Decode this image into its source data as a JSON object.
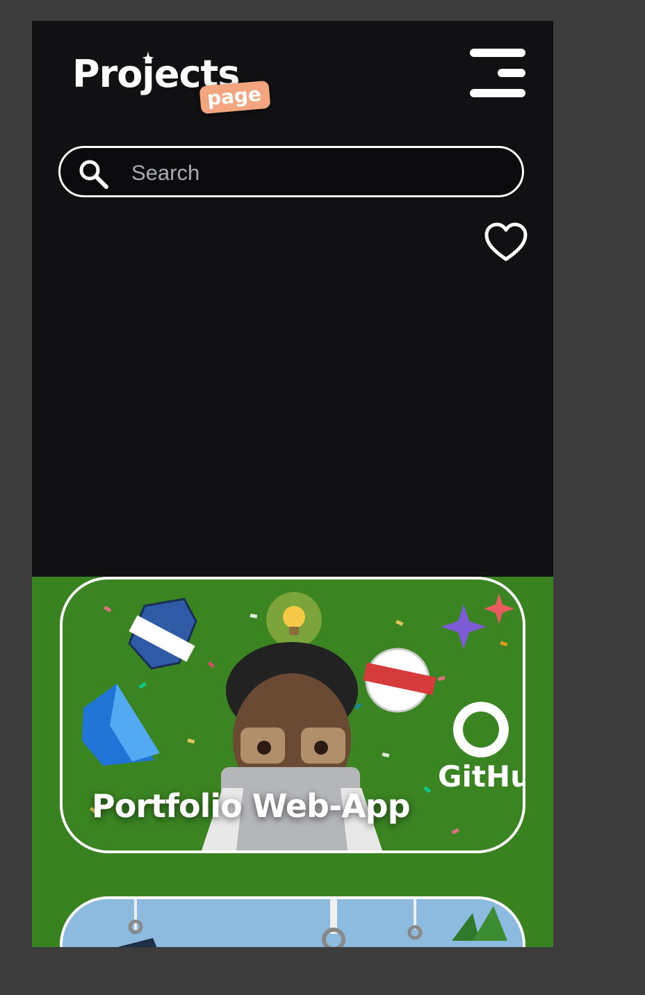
{
  "header": {
    "logo_word": "Projects",
    "logo_badge": "page",
    "menu_icon": "menu-icon"
  },
  "search": {
    "placeholder": "Search",
    "value": "",
    "icon": "search-icon"
  },
  "favorites": {
    "icon": "heart-icon"
  },
  "projects": [
    {
      "title": "Portfolio Web-App",
      "art_github_label": "GitHub"
    },
    {
      "title": ""
    }
  ],
  "colors": {
    "background": "#111113",
    "outer": "#3c3c3c",
    "section_green": "#38821f",
    "badge_orange": "#f2a57e",
    "search_placeholder": "#a7abb3"
  }
}
